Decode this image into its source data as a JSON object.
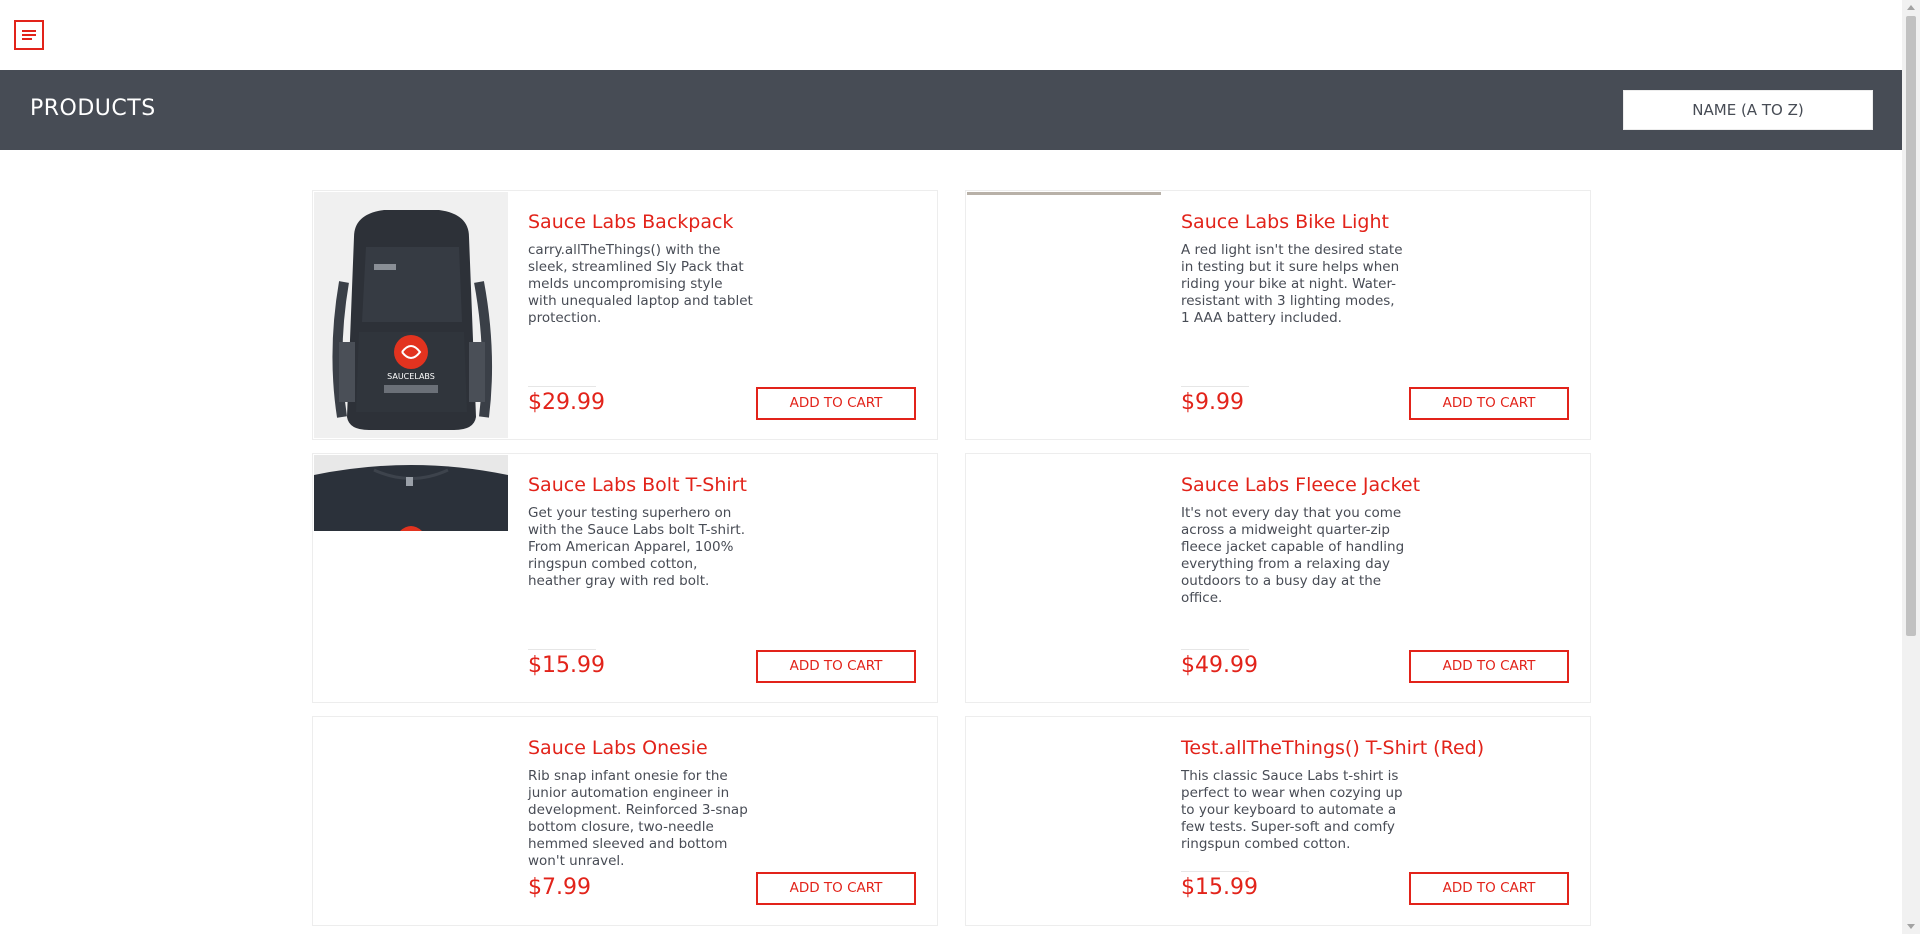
{
  "header": {
    "menu_icon": "hamburger-menu-icon"
  },
  "subheader": {
    "title": "PRODUCTS",
    "sort_selected": "NAME (A TO Z)"
  },
  "products": [
    {
      "name": "Sauce Labs Backpack",
      "description": "carry.allTheThings() with the sleek, streamlined Sly Pack that melds uncompromising style with unequaled laptop and tablet protection.",
      "price": "$29.99",
      "button": "ADD TO CART"
    },
    {
      "name": "Sauce Labs Bike Light",
      "description": "A red light isn't the desired state in testing but it sure helps when riding your bike at night. Water-resistant with 3 lighting modes, 1 AAA battery included.",
      "price": "$9.99",
      "button": "ADD TO CART"
    },
    {
      "name": "Sauce Labs Bolt T-Shirt",
      "description": "Get your testing superhero on with the Sauce Labs bolt T-shirt. From American Apparel, 100% ringspun combed cotton, heather gray with red bolt.",
      "price": "$15.99",
      "button": "ADD TO CART"
    },
    {
      "name": "Sauce Labs Fleece Jacket",
      "description": "It's not every day that you come across a midweight quarter-zip fleece jacket capable of handling everything from a relaxing day outdoors to a busy day at the office.",
      "price": "$49.99",
      "button": "ADD TO CART"
    },
    {
      "name": "Sauce Labs Onesie",
      "description": "Rib snap infant onesie for the junior automation engineer in development. Reinforced 3-snap bottom closure, two-needle hemmed sleeved and bottom won't unravel.",
      "price": "$7.99",
      "button": "ADD TO CART"
    },
    {
      "name": "Test.allTheThings() T-Shirt (Red)",
      "description": "This classic Sauce Labs t-shirt is perfect to wear when cozying up to your keyboard to automate a few tests. Super-soft and comfy ringspun combed cotton.",
      "price": "$15.99",
      "button": "ADD TO CART"
    }
  ],
  "backpack_logo_text": "SAUCELABS",
  "colors": {
    "accent": "#e2231a",
    "subheader_bg": "#474c55",
    "text": "#484c55"
  }
}
